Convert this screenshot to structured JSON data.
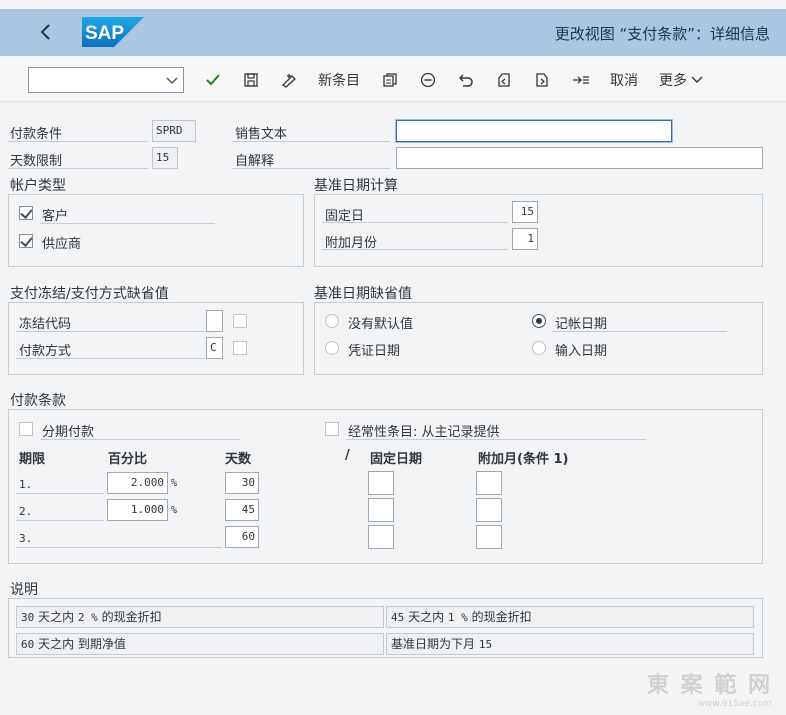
{
  "shell": {
    "title": "更改视图 “支付条款”：详细信息",
    "logo_text": "SAP"
  },
  "toolbar": {
    "new_entries": "新条目",
    "cancel": "取消",
    "more": "更多",
    "icons": [
      "check-icon",
      "save-icon",
      "glasses-icon",
      "copy-icon",
      "minus-circle-icon",
      "undo-icon",
      "prev-page-icon",
      "next-page-icon",
      "goto-icon"
    ]
  },
  "header": {
    "payment_terms_label": "付款条件",
    "payment_terms_value": "SPRD",
    "days_limit_label": "天数限制",
    "days_limit_value": "15",
    "sales_text_label": "销售文本",
    "sales_text_value": "",
    "self_explanation_label": "自解释",
    "self_explanation_value": ""
  },
  "account_type": {
    "title": "帐户类型",
    "customer_label": "客户",
    "customer_checked": true,
    "vendor_label": "供应商",
    "vendor_checked": true
  },
  "baseline_calc": {
    "title": "基准日期计算",
    "fixed_day_label": "固定日",
    "fixed_day_value": "15",
    "additional_months_label": "附加月份",
    "additional_months_value": "1"
  },
  "payment_block": {
    "title": "支付冻结/支付方式缺省值",
    "block_key_label": "冻结代码",
    "block_key_value": "",
    "payment_method_label": "付款方式",
    "payment_method_value": "C"
  },
  "baseline_default": {
    "title": "基准日期缺省值",
    "no_default": "没有默认值",
    "posting_date": "记帐日期",
    "document_date": "凭证日期",
    "entry_date": "输入日期",
    "selected": "posting_date"
  },
  "terms": {
    "title": "付款条款",
    "installment_label": "分期付款",
    "recurring_label": "经常性条目: 从主记录提供",
    "col_term": "期限",
    "col_percent": "百分比",
    "col_days": "天数",
    "col_slash": "/",
    "col_fixed_date": "固定日期",
    "col_add_month": "附加月(条件 1)",
    "percent_sign": "%",
    "rows": [
      {
        "no": "1.",
        "percent": "2.000",
        "days": "30"
      },
      {
        "no": "2.",
        "percent": "1.000",
        "days": "45"
      },
      {
        "no": "3.",
        "percent": "",
        "days": "60"
      }
    ]
  },
  "explanation": {
    "title": "说明",
    "lines": [
      {
        "num": "30",
        "text": " 天之内 ",
        "pct": "2 %",
        "tail": " 的现金折扣"
      },
      {
        "num": "45",
        "text": " 天之内 ",
        "pct": "1 %",
        "tail": " 的现金折扣"
      },
      {
        "num": "60",
        "text": " 天之内 到期净值",
        "pct": "",
        "tail": ""
      },
      {
        "num": "",
        "text": "基准日期为下月 ",
        "pct": "15",
        "tail": ""
      }
    ]
  },
  "watermark": {
    "text": "東 案 範 网",
    "url": "www.915ae.com"
  }
}
